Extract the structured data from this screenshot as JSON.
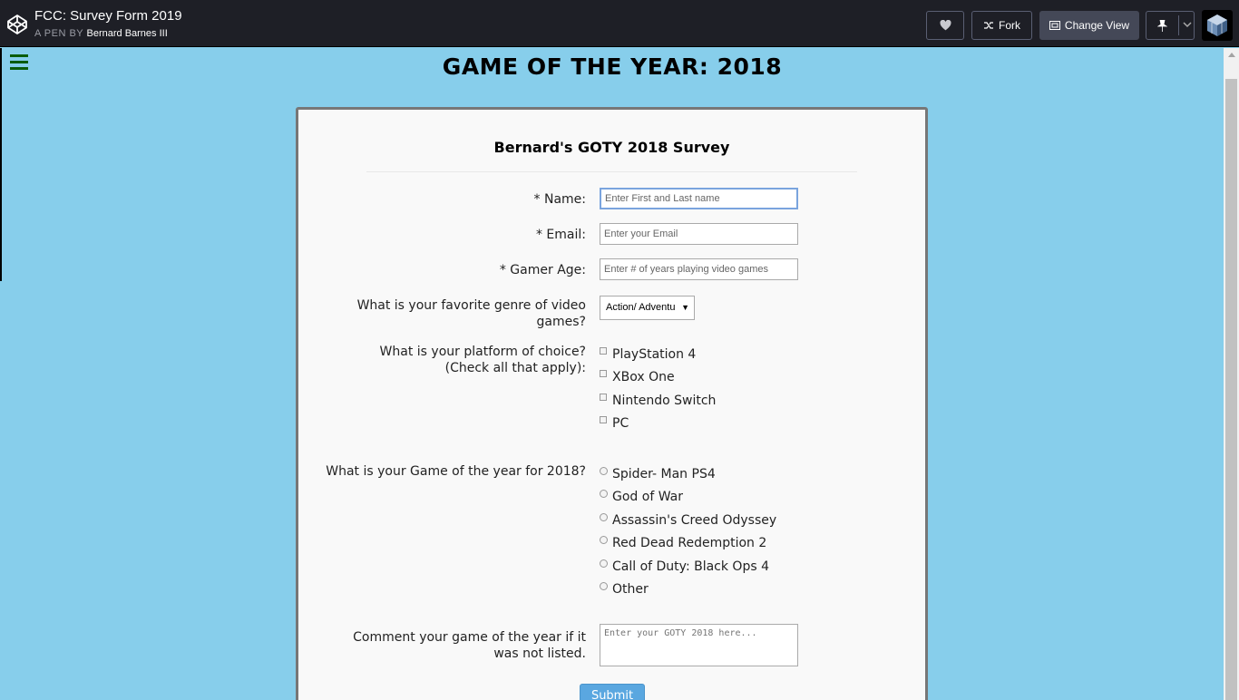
{
  "header": {
    "title": "FCC: Survey Form 2019",
    "by_prefix": "A PEN BY",
    "author": "Bernard Barnes III",
    "buttons": {
      "fork": "Fork",
      "change_view": "Change View"
    }
  },
  "page": {
    "title": "GAME OF THE YEAR: 2018"
  },
  "survey": {
    "title": "Bernard's GOTY 2018 Survey",
    "name": {
      "label": "* Name:",
      "placeholder": "Enter First and Last name"
    },
    "email": {
      "label": "* Email:",
      "placeholder": "Enter your Email"
    },
    "age": {
      "label": "* Gamer Age:",
      "placeholder": "Enter # of years playing video games"
    },
    "genre": {
      "label_line1": "What is your favorite genre of video",
      "label_line2": "games?",
      "selected": "Action/ Adventu"
    },
    "platform": {
      "label_line1": "What is your platform of choice?",
      "label_line2": "(Check all that apply):",
      "options": [
        "PlayStation 4",
        "XBox One",
        "Nintendo Switch",
        "PC"
      ]
    },
    "goty": {
      "label": "What is your Game of the year for 2018?",
      "options": [
        "Spider- Man PS4",
        "God of War",
        "Assassin's Creed Odyssey",
        "Red Dead Redemption 2",
        "Call of Duty: Black Ops 4",
        "Other"
      ]
    },
    "comment": {
      "label_line1": "Comment your game of the year if it",
      "label_line2": "was not listed.",
      "placeholder": "Enter your GOTY 2018 here..."
    },
    "submit": "Submit"
  },
  "colors": {
    "page_bg": "#87ceeb",
    "header_bg": "#1e1f26",
    "submit_bg": "#5aa7e0",
    "menu_icon": "#0a5c0a"
  },
  "icons": [
    "codepen-logo-icon",
    "heart-icon",
    "fork-icon",
    "change-view-icon",
    "pin-icon",
    "chevron-down-icon",
    "hamburger-menu-icon",
    "user-avatar"
  ]
}
